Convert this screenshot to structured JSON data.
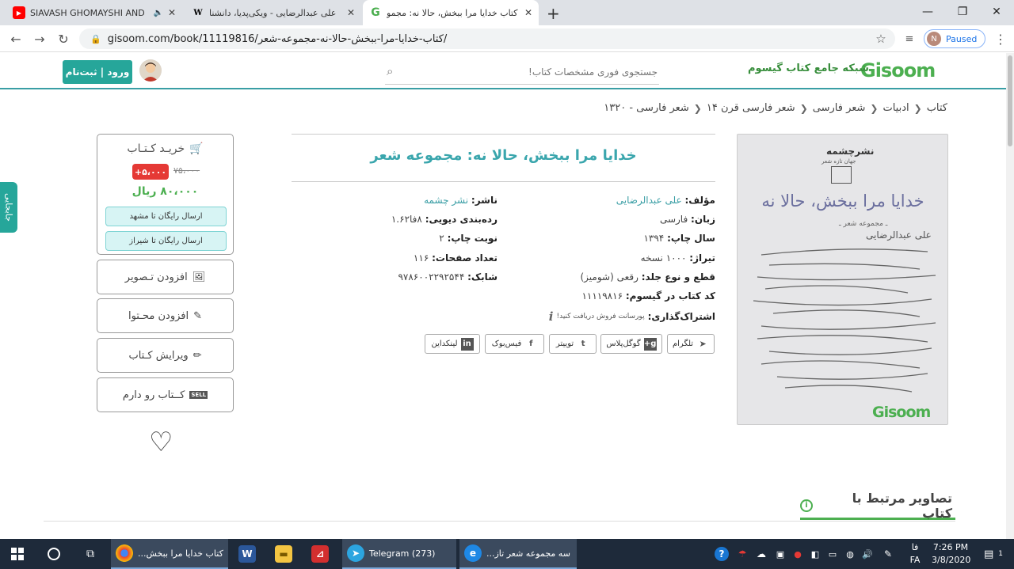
{
  "browser": {
    "tabs": [
      {
        "title": "SIAVASH GHOMAYSHI AND M",
        "favicon": "youtube-icon",
        "color": "#ff0000"
      },
      {
        "title": "علی عبدالرضایی - ویکی‌پدیا، دانشنا",
        "favicon": "wikipedia-icon",
        "color": "#000000"
      },
      {
        "title": "کتاب خدایا مرا ببخش، حالا نه: مجمو",
        "favicon": "gisoom-icon",
        "color": "#4caf50"
      }
    ],
    "url": "gisoom.com/book/11119816/کتاب-خدایا-مرا-ببخش-حالا-نه-مجموعه-شعر/",
    "profile_initial": "N",
    "profile_status": "Paused"
  },
  "site": {
    "logo": "Gisoom",
    "network_label": "شبکه جامع کتاب گیسوم",
    "search_placeholder": "جستجوی فوری مشخصات کتاب!",
    "login_label": "ورود | ثبت‌نام",
    "side_tab": "جابجایی",
    "accent": "#3a9ea5"
  },
  "breadcrumb": [
    "کتاب",
    "ادبیات",
    "شعر فارسی",
    "شعر فارسی قرن ۱۴",
    "شعر فارسی - ۱۳۲۰"
  ],
  "cover": {
    "publisher_mark": "نشرچشمه",
    "publisher_small": "جهان تازه شعر",
    "title": "خدایا مرا ببخش، حالا نه",
    "subtitle": "ـ مجموعه شعر ـ",
    "author": "علی عبدالرضایی",
    "logo": "Gisoom"
  },
  "book": {
    "title": "خدایا مرا ببخش، حالا نه: مجموعه شعر",
    "author_label": "مؤلف:",
    "author": "علی عبدالرضایی",
    "publisher_label": "ناشر:",
    "publisher": "نشر چشمه",
    "language_label": "زبان:",
    "language": "فارسی",
    "dewey_label": "رده‌بندی دیویی:",
    "dewey": "۸فا۱.۶۲",
    "year_label": "سال چاپ:",
    "year": "۱۳۹۴",
    "edition_label": "نوبت چاپ:",
    "edition": "۲",
    "print_run_label": "تیراژ:",
    "print_run": "۱۰۰۰ نسخه",
    "pages_label": "تعداد صفحات:",
    "pages": "۱۱۶",
    "format_label": "قطع و نوع جلد:",
    "format": "رقعی (شومیز)",
    "isbn_label": "شابک:",
    "isbn": "۹۷۸۶۰۰۲۲۹۲۵۴۴",
    "gisoom_code_label": "کد کتاب در گیسوم:",
    "gisoom_code": "۱۱۱۱۹۸۱۶",
    "share_label": "اشتراک‌گذاری:",
    "share_note": "پورسانت فروش دریافت کنید!"
  },
  "share_buttons": [
    {
      "label": "تلگرام",
      "icon": "telegram-icon",
      "glyph": "➤"
    },
    {
      "label": "گوگل‌پلاس",
      "icon": "google-plus-icon",
      "glyph": "g+"
    },
    {
      "label": "توییتر",
      "icon": "twitter-icon",
      "glyph": "t"
    },
    {
      "label": "فیس‌بوک",
      "icon": "facebook-icon",
      "glyph": "f"
    },
    {
      "label": "لینکداین",
      "icon": "linkedin-icon",
      "glyph": "in"
    }
  ],
  "purchase": {
    "title": "خریـد کـتـاب",
    "old_price": "۷۵،۰۰۰",
    "discount": "+۵،۰۰۰",
    "price": "۸۰،۰۰۰ ریال",
    "ship_1": "ارسال رایگان تا مشهد",
    "ship_2": "ارسال رایگان تا شیراز",
    "add_image": "افزودن تـصویر",
    "add_content": "افزودن محـتوا",
    "edit_book": "ویرایش کـتاب",
    "have_book": "کــتاب رو دارم",
    "sell_badge": "SELL"
  },
  "related": {
    "title": "تصاویر مرتبط با کتاب"
  },
  "taskbar": {
    "apps": [
      {
        "label": "...کتاب خدایا مرا ببخش",
        "icon": "chrome-icon"
      },
      {
        "label": "",
        "icon": "word-icon"
      },
      {
        "label": "",
        "icon": "folder-icon"
      },
      {
        "label": "",
        "icon": "pdf-icon"
      },
      {
        "label": "Telegram (273)",
        "icon": "telegram-icon",
        "badge": "273"
      },
      {
        "label": "...سه مجموعه شعر تاز",
        "icon": "edge-icon"
      }
    ],
    "lang": "فا",
    "lang2": "FA",
    "time": "7:26 PM",
    "date": "3/8/2020",
    "notification_count": "1"
  }
}
